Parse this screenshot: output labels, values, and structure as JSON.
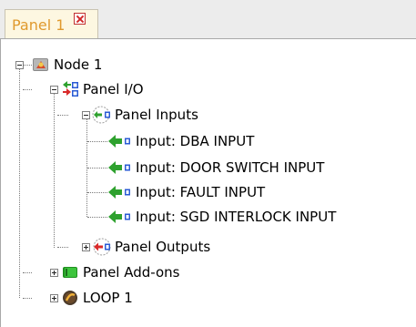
{
  "tab": {
    "label": "Panel 1"
  },
  "tree": {
    "root": "Node 1",
    "panel_io": "Panel I/O",
    "panel_inputs": "Panel Inputs",
    "inputs": [
      "Input: DBA INPUT",
      "Input: DOOR SWITCH INPUT",
      "Input: FAULT INPUT",
      "Input: SGD INTERLOCK INPUT"
    ],
    "panel_outputs": "Panel Outputs",
    "panel_addons": "Panel Add-ons",
    "loop": "LOOP 1"
  },
  "icons": {
    "root": "node-icon",
    "panel_io": "panel-io-icon",
    "panel_inputs": "panel-inputs-icon",
    "input": "input-arrow-icon",
    "panel_outputs": "panel-outputs-icon",
    "panel_addons": "panel-addons-icon",
    "loop": "loop-icon"
  }
}
